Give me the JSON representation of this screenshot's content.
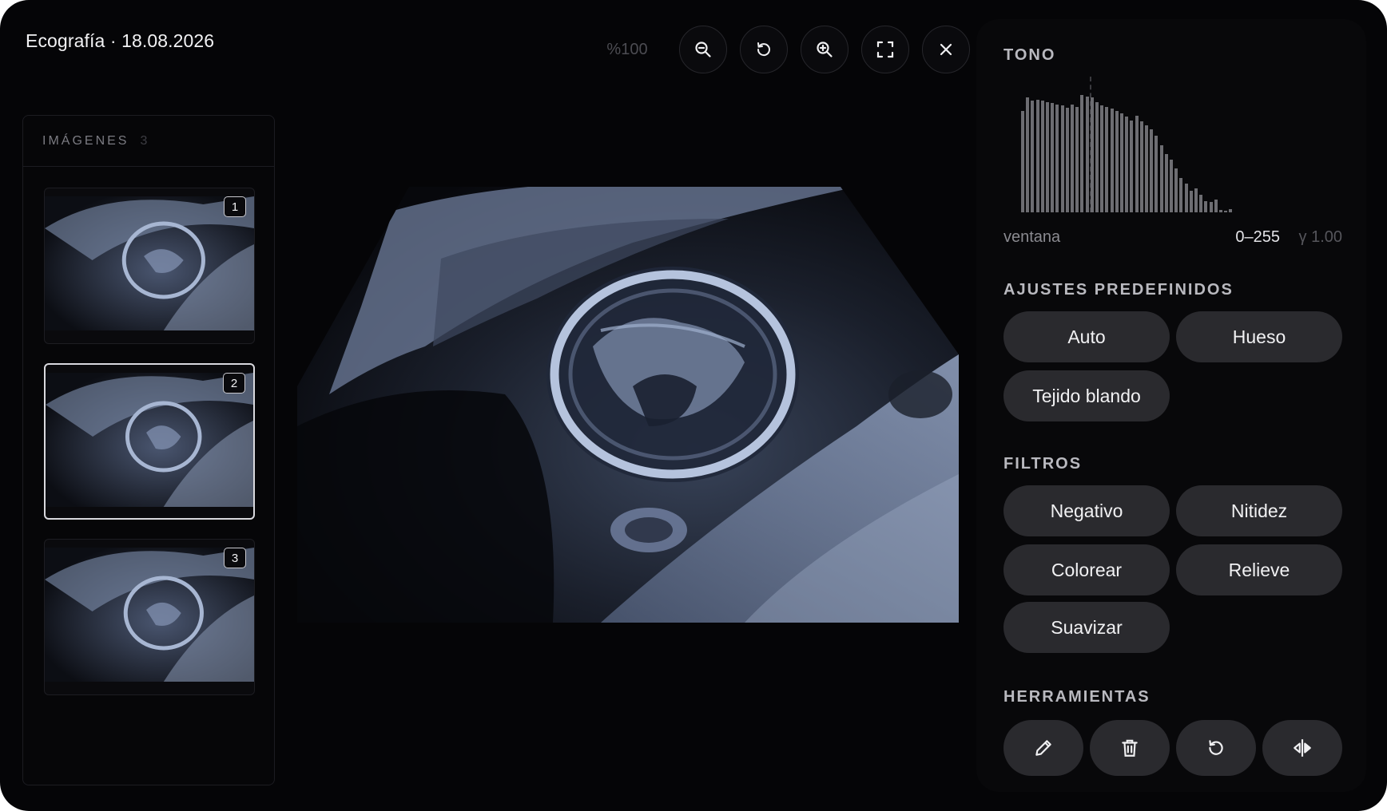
{
  "header": {
    "title": "Ecografía · 18.08.2026"
  },
  "toolbar": {
    "zoom_level": "%100",
    "buttons": [
      {
        "icon": "zoom-out-icon"
      },
      {
        "icon": "rotate-icon"
      },
      {
        "icon": "zoom-in-icon"
      },
      {
        "icon": "fullscreen-icon"
      },
      {
        "icon": "close-icon"
      }
    ]
  },
  "images_panel": {
    "title": "IMÁGENES",
    "count": "3",
    "thumbnails": [
      {
        "badge": "1",
        "active": false
      },
      {
        "badge": "2",
        "active": true
      },
      {
        "badge": "3",
        "active": false
      }
    ]
  },
  "tone": {
    "title": "TONO",
    "histogram": [
      88,
      100,
      97,
      98,
      97,
      96,
      95,
      94,
      93,
      91,
      94,
      92,
      102,
      101,
      100,
      96,
      93,
      92,
      90,
      88,
      86,
      83,
      80,
      84,
      79,
      76,
      72,
      67,
      58,
      51,
      46,
      38,
      30,
      25,
      19,
      21,
      15,
      10,
      9,
      11,
      2,
      1,
      3
    ],
    "window_label": "ventana",
    "window_range": "0–255",
    "gamma": "γ 1.00"
  },
  "presets": {
    "title": "AJUSTES PREDEFINIDOS",
    "items": [
      "Auto",
      "Hueso",
      "Tejido blando"
    ]
  },
  "filters": {
    "title": "FILTROS",
    "items": [
      "Negativo",
      "Nitidez",
      "Colorear",
      "Relieve",
      "Suavizar"
    ]
  },
  "tools": {
    "title": "HERRAMIENTAS",
    "items": [
      {
        "icon": "pencil-icon"
      },
      {
        "icon": "trash-icon"
      },
      {
        "icon": "reset-icon"
      },
      {
        "icon": "flip-icon"
      }
    ]
  },
  "colors": {
    "background": "#050507",
    "panel": "#08080a",
    "pill": "#2a2a2e",
    "ultrasound_tint": "#8fa3c4"
  }
}
